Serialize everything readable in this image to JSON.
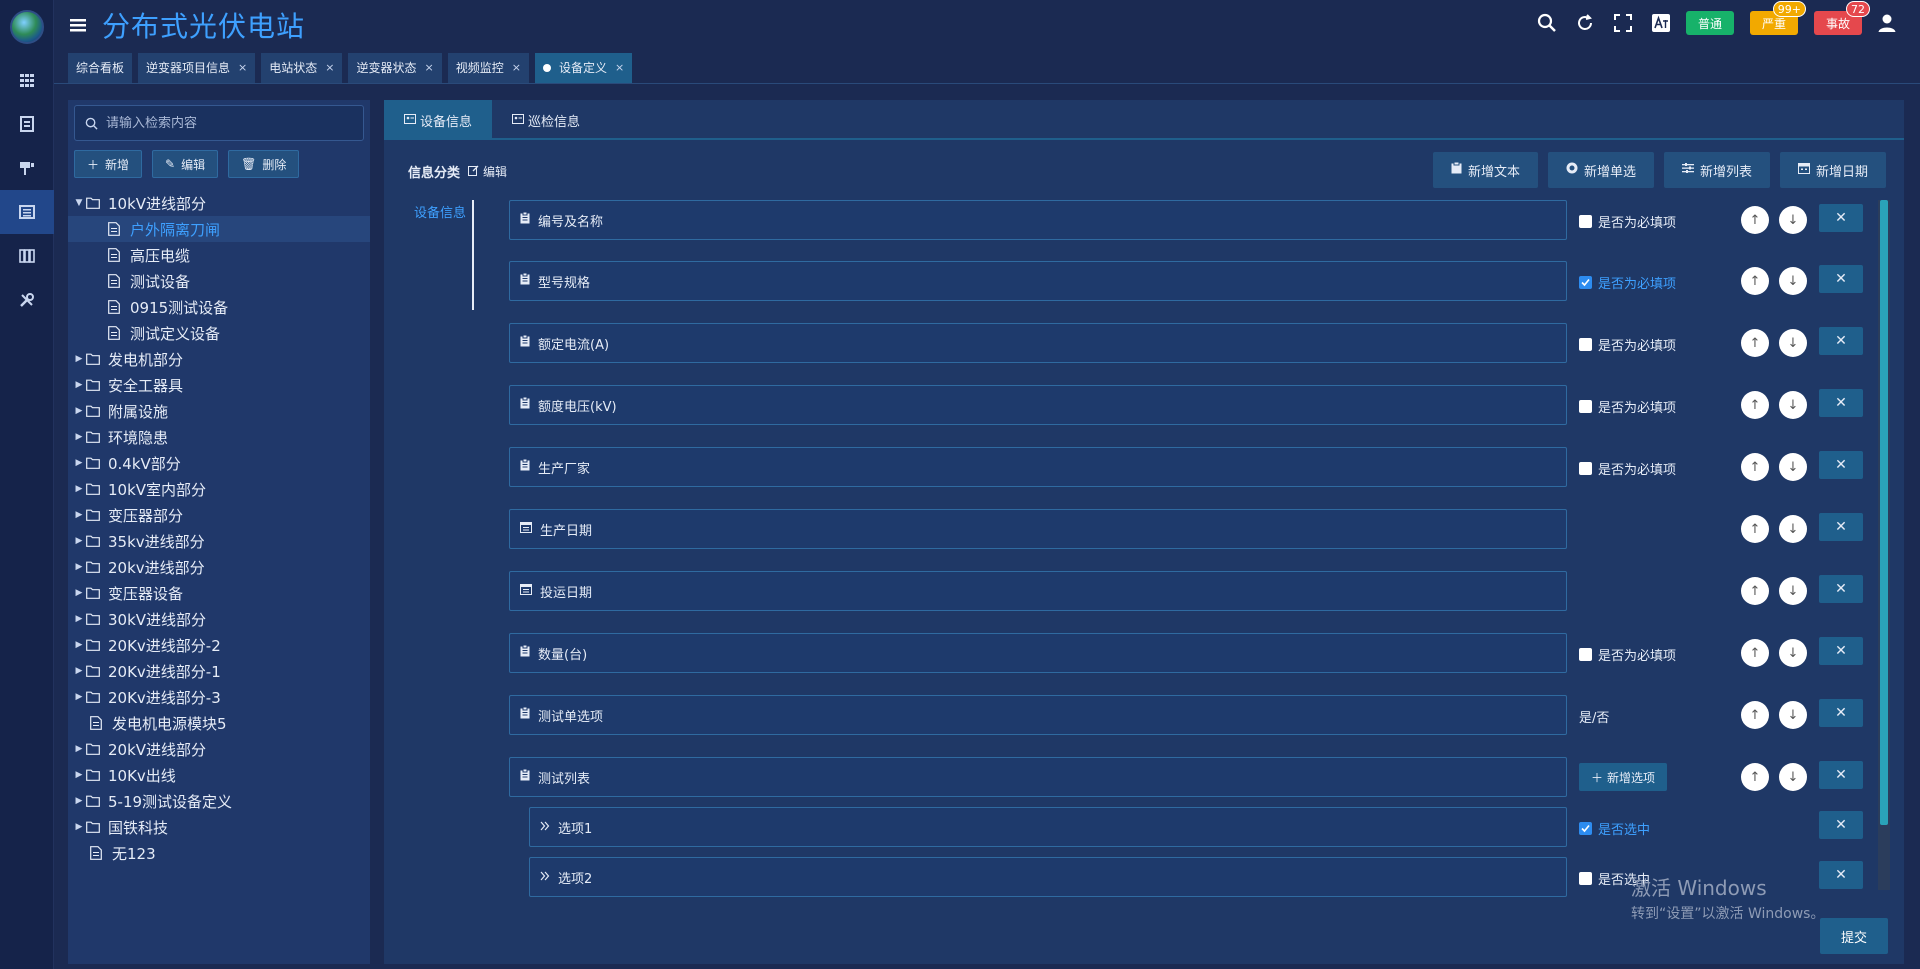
{
  "app": {
    "title": "分布式光伏电站"
  },
  "header": {
    "alerts": [
      {
        "label": "普通",
        "color": "#17b26a",
        "count": ""
      },
      {
        "label": "严重",
        "color": "#f2a900",
        "count": "99+"
      },
      {
        "label": "事故",
        "color": "#e5484d",
        "count": "72"
      }
    ]
  },
  "tabs": [
    {
      "label": "综合看板",
      "closable": false,
      "active": false
    },
    {
      "label": "逆变器项目信息",
      "closable": true,
      "active": false
    },
    {
      "label": "电站状态",
      "closable": true,
      "active": false
    },
    {
      "label": "逆变器状态",
      "closable": true,
      "active": false
    },
    {
      "label": "视频监控",
      "closable": true,
      "active": false
    },
    {
      "label": "设备定义",
      "closable": true,
      "active": true
    }
  ],
  "tree": {
    "search_placeholder": "请输入检索内容",
    "actions": [
      "新增",
      "编辑",
      "删除"
    ],
    "nodes": [
      {
        "label": "10kV进线部分",
        "type": "folder",
        "level": 0,
        "expanded": true
      },
      {
        "label": "户外隔离刀闸",
        "type": "file",
        "level": 1,
        "selected": true
      },
      {
        "label": "高压电缆",
        "type": "file",
        "level": 1
      },
      {
        "label": "测试设备",
        "type": "file",
        "level": 1
      },
      {
        "label": "0915测试设备",
        "type": "file",
        "level": 1
      },
      {
        "label": "测试定义设备",
        "type": "file",
        "level": 1
      },
      {
        "label": "发电机部分",
        "type": "folder",
        "level": 0
      },
      {
        "label": "安全工器具",
        "type": "folder",
        "level": 0
      },
      {
        "label": "附属设施",
        "type": "folder",
        "level": 0
      },
      {
        "label": "环境隐患",
        "type": "folder",
        "level": 0
      },
      {
        "label": "0.4kV部分",
        "type": "folder",
        "level": 0
      },
      {
        "label": "10kV室内部分",
        "type": "folder",
        "level": 0
      },
      {
        "label": "变压器部分",
        "type": "folder",
        "level": 0
      },
      {
        "label": "35kv进线部分",
        "type": "folder",
        "level": 0
      },
      {
        "label": "20kv进线部分",
        "type": "folder",
        "level": 0
      },
      {
        "label": "变压器设备",
        "type": "folder",
        "level": 0
      },
      {
        "label": "30kV进线部分",
        "type": "folder",
        "level": 0
      },
      {
        "label": "20Kv进线部分-2",
        "type": "folder",
        "level": 0
      },
      {
        "label": "20Kv进线部分-1",
        "type": "folder",
        "level": 0
      },
      {
        "label": "20Kv进线部分-3",
        "type": "folder",
        "level": 0
      },
      {
        "label": "发电机电源模块5",
        "type": "file",
        "level": 0,
        "leaf": true
      },
      {
        "label": "20kV进线部分",
        "type": "folder",
        "level": 0
      },
      {
        "label": "10Kv出线",
        "type": "folder",
        "level": 0
      },
      {
        "label": "5-19测试设备定义",
        "type": "folder",
        "level": 0
      },
      {
        "label": "国铁科技",
        "type": "folder",
        "level": 0
      },
      {
        "label": "无123",
        "type": "file",
        "level": 0,
        "leaf": true
      }
    ]
  },
  "main": {
    "tabs": [
      "设备信息",
      "巡检信息"
    ],
    "category_label": "信息分类",
    "category_edit": "编辑",
    "category_item": "设备信息",
    "toolbar": [
      "新增文本",
      "新增单选",
      "新增列表",
      "新增日期"
    ],
    "fields": [
      {
        "label": "编号及名称",
        "kind": "text",
        "required": false,
        "req_label": "是否为必填项"
      },
      {
        "label": "型号规格",
        "kind": "text",
        "required": true,
        "req_label": "是否为必填项"
      },
      {
        "label": "额定电流(A)",
        "kind": "text",
        "required": false,
        "req_label": "是否为必填项"
      },
      {
        "label": "额度电压(kV)",
        "kind": "text",
        "required": false,
        "req_label": "是否为必填项"
      },
      {
        "label": "生产厂家",
        "kind": "text",
        "required": false,
        "req_label": "是否为必填项"
      },
      {
        "label": "生产日期",
        "kind": "date"
      },
      {
        "label": "投运日期",
        "kind": "date"
      },
      {
        "label": "数量(台)",
        "kind": "text",
        "required": false,
        "req_label": "是否为必填项"
      },
      {
        "label": "测试单选项",
        "kind": "radio",
        "extra": "是/否"
      },
      {
        "label": "测试列表",
        "kind": "list",
        "extra": "新增选项"
      },
      {
        "label": "选项1",
        "kind": "option",
        "required": true,
        "req_label": "是否选中"
      },
      {
        "label": "选项2",
        "kind": "option",
        "required": false,
        "req_label": "是否选中"
      }
    ],
    "submit": "提交"
  },
  "watermark": {
    "line1": "激活 Windows",
    "line2": "转到“设置”以激活 Windows。"
  }
}
